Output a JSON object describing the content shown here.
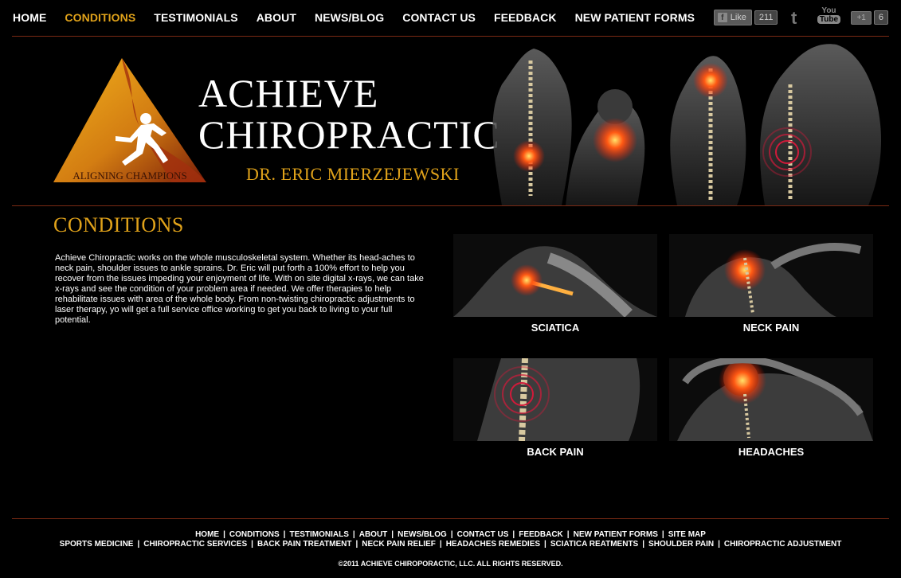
{
  "nav": {
    "items": [
      {
        "label": "HOME",
        "active": false
      },
      {
        "label": "CONDITIONS",
        "active": true
      },
      {
        "label": "TESTIMONIALS",
        "active": false
      },
      {
        "label": "ABOUT",
        "active": false
      },
      {
        "label": "NEWS/BLOG",
        "active": false
      },
      {
        "label": "CONTACT US",
        "active": false
      },
      {
        "label": "FEEDBACK",
        "active": false
      },
      {
        "label": "NEW PATIENT FORMS",
        "active": false
      }
    ]
  },
  "social": {
    "fb_like_label": "Like",
    "fb_like_count": "211",
    "youtube_top": "You",
    "youtube_bottom": "Tube",
    "plusone_label": "+1",
    "plusone_count": "6"
  },
  "header": {
    "logo_tagline": "ALIGNING CHAMPIONS",
    "brand_line1": "ACHIEVE",
    "brand_line2": "CHIROPRACTIC",
    "doctor": "DR. ERIC MIERZEJEWSKI"
  },
  "main": {
    "title": "CONDITIONS",
    "intro": "Achieve Chiropractic works on the whole musculoskeletal system. Whether its head-aches to neck pain, shoulder issues to ankle sprains. Dr. Eric will put forth a 100% effort to help you recover from the issues impeding your enjoyment of life. With on site digital x-rays, we can take x-rays and see the condition of your problem area if needed. We offer therapies to help rehabilitate issues with area of the whole body. From non-twisting chiropractic adjustments to laser therapy, yo will get a full service office working to get you back to living to your full potential.",
    "conditions": [
      {
        "label": "SCIATICA"
      },
      {
        "label": "NECK PAIN"
      },
      {
        "label": "BACK PAIN"
      },
      {
        "label": "HEADACHES"
      }
    ]
  },
  "footer": {
    "row1": [
      "HOME",
      "CONDITIONS",
      "TESTIMONIALS",
      "ABOUT",
      "NEWS/BLOG",
      "CONTACT US",
      "FEEDBACK",
      "NEW PATIENT FORMS",
      "SITE MAP"
    ],
    "row2": [
      "SPORTS MEDICINE",
      "CHIROPRACTIC SERVICES",
      "BACK PAIN TREATMENT",
      "NECK PAIN RELIEF",
      "HEADACHES REMEDIES",
      "SCIATICA REATMENTS",
      "SHOULDER PAIN",
      "CHIROPRACTIC ADJUSTMENT"
    ],
    "separator": "|",
    "copyright": "©2011 ACHIEVE CHIROPORACTIC, LLC. ALL RIGHTS RESERVED."
  },
  "colors": {
    "accent": "#e0a21a",
    "rule": "#7a2a14",
    "background": "#000000"
  }
}
